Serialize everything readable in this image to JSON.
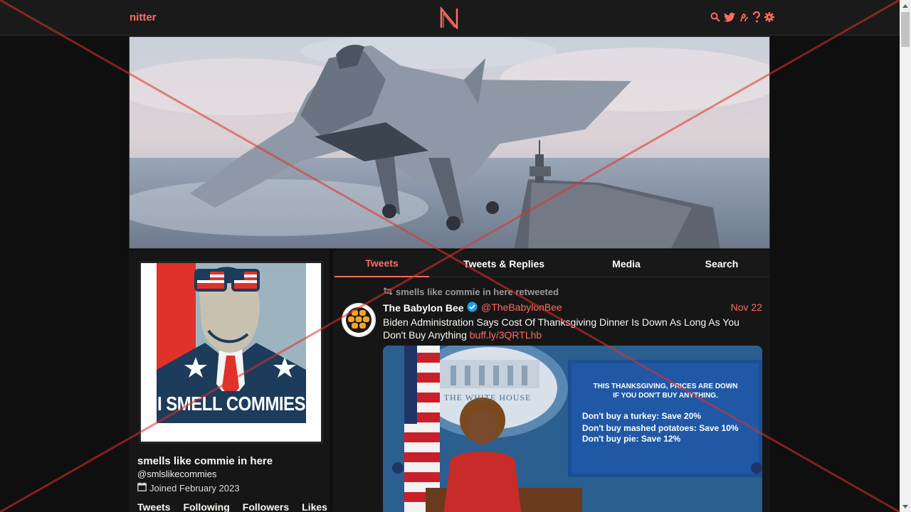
{
  "navbar": {
    "brand": "nitter",
    "logo_letter": "N",
    "icons": [
      "search-icon",
      "twitter-bird-icon",
      "rss-icon",
      "help-icon",
      "gear-icon"
    ]
  },
  "profile": {
    "fullname": "smells like commie in here",
    "username": "@smlslikecommies",
    "joined": "Joined February 2023",
    "stats": [
      "Tweets",
      "Following",
      "Followers",
      "Likes"
    ],
    "avatar_caption": "I SMELL COMMIES"
  },
  "tabs": [
    {
      "label": "Tweets",
      "active": true
    },
    {
      "label": "Tweets & Replies",
      "active": false
    },
    {
      "label": "Media",
      "active": false
    },
    {
      "label": "Search",
      "active": false
    }
  ],
  "tweet": {
    "retweet_header": "smells like commie in here retweeted",
    "fullname": "The Babylon Bee",
    "username": "@TheBabylonBee",
    "date": "Nov 22",
    "text": "Biden Administration Says Cost Of Thanksgiving Dinner Is Down As Long As You Don't Buy Anything",
    "link": "buff.ly/3QRTLhb",
    "media": {
      "seal_text": "THE WHITE HOUSE",
      "screen_title_1": "THIS THANKSGIVING, PRICES ARE DOWN",
      "screen_title_2": "IF YOU DON'T BUY ANYTHING.",
      "screen_lines": [
        "Don't buy a turkey: Save 20%",
        "Don't buy mashed potatoes: Save 10%",
        "Don't buy pie: Save 12%"
      ]
    }
  },
  "colors": {
    "accent": "#ff6c60",
    "background": "#0f0f0f",
    "panel": "#161616"
  }
}
